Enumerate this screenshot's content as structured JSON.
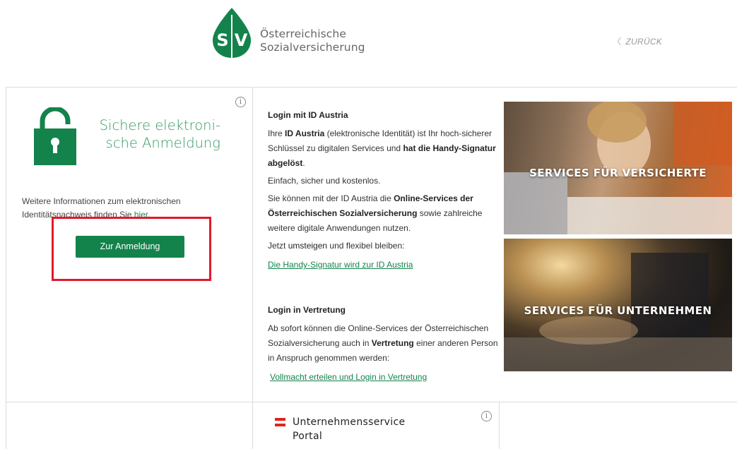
{
  "header": {
    "logo_text": "SV",
    "brand_line1": "Österreichische",
    "brand_line2": "Sozialversicherung",
    "back_label": "ZURÜCK"
  },
  "left_panel": {
    "info_glyph": "i",
    "title_line1": "Sichere elektroni-",
    "title_line2": "sche Anmeldung",
    "info_text": "Weitere Informationen zum elektronischen Identitätsnachweis finden Sie ",
    "info_link": "hier",
    "info_text_end": ".",
    "login_button": "Zur Anmeldung",
    "icon": "lock-icon",
    "accent_color": "#13834b",
    "highlight_color": "#e0192b"
  },
  "middle_panel": {
    "section1": {
      "heading": "Login mit ID Austria",
      "p1_a": "Ihre ",
      "p1_b": "ID Austria",
      "p1_c": " (elektronische Identität) ist Ihr hoch-sicherer Schlüssel zu digitalen Services und ",
      "p1_d": "hat die Handy-Signatur abgelöst",
      "p1_e": ".",
      "p2": "Einfach, sicher und kostenlos.",
      "p3_a": "Sie können mit der ID Austria die ",
      "p3_b": "Online-Services der Österreichischen Sozialversicherung",
      "p3_c": " sowie zahlreiche weitere digitale Anwendungen nutzen.",
      "p4_a": "Jetzt ",
      "p4_b": "umsteigen",
      "p4_c": " und flexibel bleiben:",
      "link": "Die Handy-Signatur wird zur ID Austria"
    },
    "section2": {
      "heading": "Login in Vertretung",
      "p1_a": "Ab sofort können die Online-Services der Österreichischen Sozialversicherung auch in ",
      "p1_b": "Vertretung",
      "p1_c": " einer anderen Person in Anspruch genommen werden:",
      "link": "Vollmacht erteilen und Login in Vertretung"
    }
  },
  "tiles": [
    {
      "label": "SERVICES FÜR VERSICHERTE"
    },
    {
      "label": "SERVICES FÜR UNTERNEHMEN"
    }
  ],
  "bottom": {
    "usp_line1": "Unternehmensservice",
    "usp_line2": "Portal",
    "info_glyph": "i"
  }
}
